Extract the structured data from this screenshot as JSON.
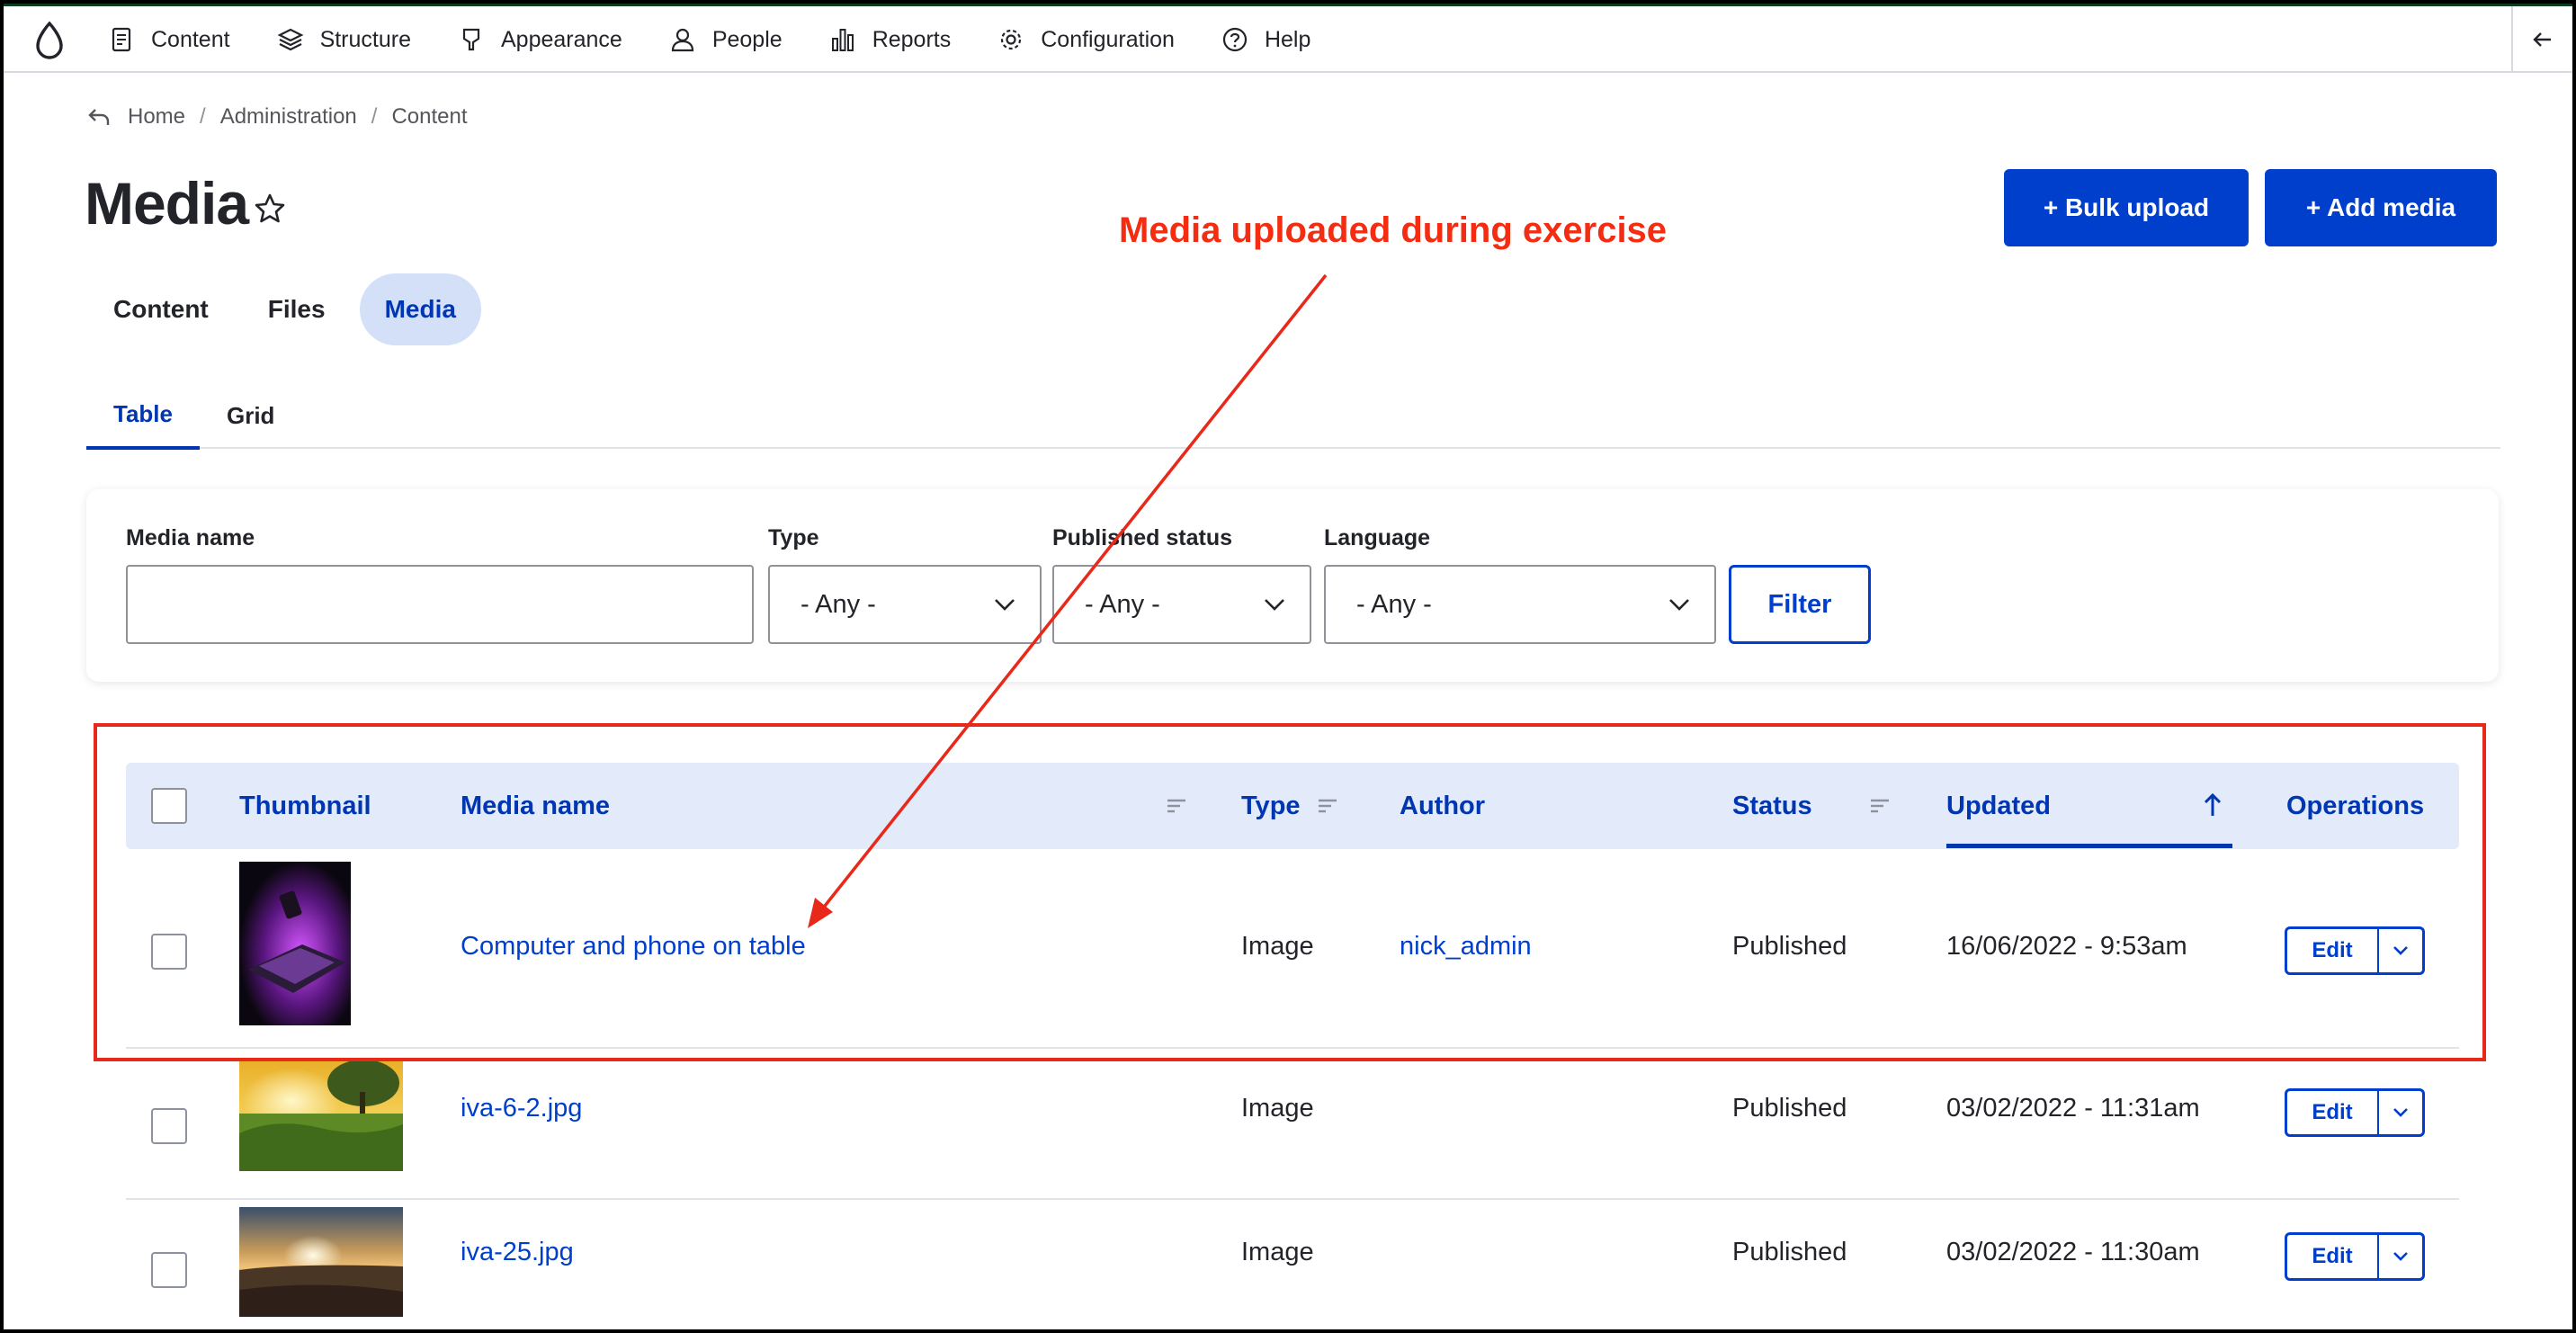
{
  "toolbar": {
    "items": [
      {
        "label": "Content",
        "icon": "content-icon"
      },
      {
        "label": "Structure",
        "icon": "structure-icon"
      },
      {
        "label": "Appearance",
        "icon": "appearance-icon"
      },
      {
        "label": "People",
        "icon": "people-icon"
      },
      {
        "label": "Reports",
        "icon": "reports-icon"
      },
      {
        "label": "Configuration",
        "icon": "gear-icon"
      },
      {
        "label": "Help",
        "icon": "help-icon"
      }
    ]
  },
  "breadcrumb": [
    "Home",
    "Administration",
    "Content"
  ],
  "page": {
    "title": "Media"
  },
  "actions": {
    "bulk_upload": "+ Bulk upload",
    "add_media": "+ Add media"
  },
  "annotation": {
    "text": "Media uploaded during exercise",
    "color": "#f32c12"
  },
  "primary_tabs": [
    {
      "label": "Content",
      "active": false
    },
    {
      "label": "Files",
      "active": false
    },
    {
      "label": "Media",
      "active": true
    }
  ],
  "secondary_tabs": [
    {
      "label": "Table",
      "active": true
    },
    {
      "label": "Grid",
      "active": false
    }
  ],
  "filters": {
    "media_name_label": "Media name",
    "media_name_value": "",
    "type_label": "Type",
    "type_value": "- Any -",
    "published_label": "Published status",
    "published_value": "- Any -",
    "language_label": "Language",
    "language_value": "- Any -",
    "filter_button": "Filter"
  },
  "table": {
    "headers": {
      "thumbnail": "Thumbnail",
      "media_name": "Media name",
      "type": "Type",
      "author": "Author",
      "status": "Status",
      "updated": "Updated",
      "operations": "Operations"
    },
    "rows": [
      {
        "name": "Computer and phone on table",
        "type": "Image",
        "author": "nick_admin",
        "status": "Published",
        "updated": "16/06/2022 - 9:53am",
        "edit": "Edit"
      },
      {
        "name": "iva-6-2.jpg",
        "type": "Image",
        "author": "",
        "status": "Published",
        "updated": "03/02/2022 - 11:31am",
        "edit": "Edit"
      },
      {
        "name": "iva-25.jpg",
        "type": "Image",
        "author": "",
        "status": "Published",
        "updated": "03/02/2022 - 11:30am",
        "edit": "Edit"
      }
    ]
  },
  "colors": {
    "accent": "#003ecc",
    "annotation_red": "#e8291a"
  }
}
